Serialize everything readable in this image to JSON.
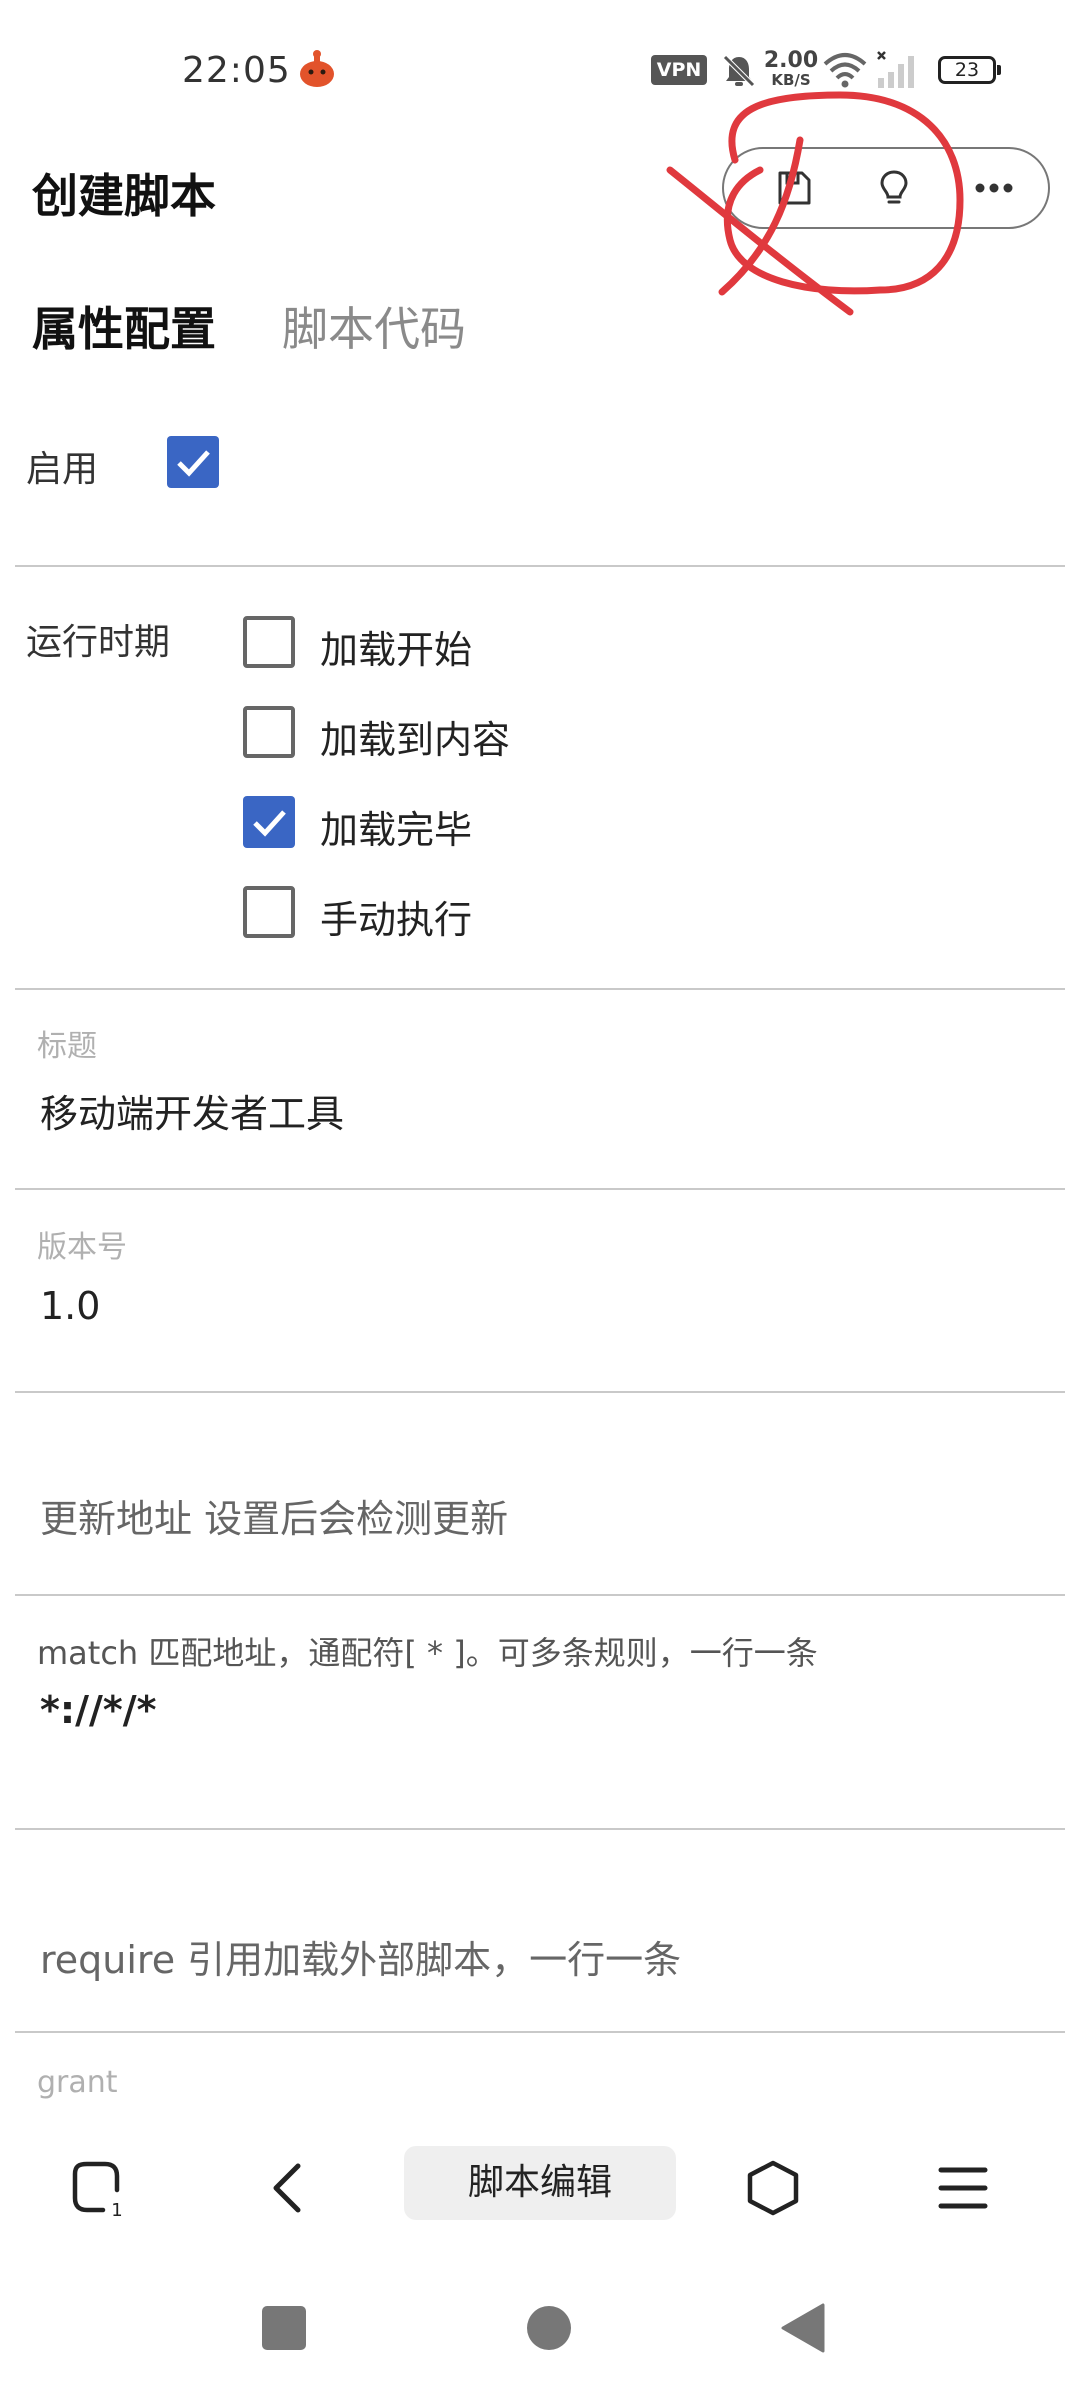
{
  "status_bar": {
    "time": "22:05",
    "vpn": "VPN",
    "net_speed_value": "2.00",
    "net_speed_unit": "KB/S",
    "battery": "23",
    "icons": [
      "app-notification-icon",
      "bell-muted-icon",
      "wifi-icon",
      "signal-icon",
      "battery-icon"
    ]
  },
  "header": {
    "title": "创建脚本",
    "actions": [
      "save-icon",
      "lightbulb-icon",
      "more-icon"
    ]
  },
  "tabs": [
    {
      "label": "属性配置",
      "active": true
    },
    {
      "label": "脚本代码",
      "active": false
    }
  ],
  "form": {
    "enabled_label": "启用",
    "enabled_checked": true,
    "run_at_label": "运行时期",
    "run_at_options": [
      {
        "label": "加载开始",
        "checked": false
      },
      {
        "label": "加载到内容",
        "checked": false
      },
      {
        "label": "加载完毕",
        "checked": true
      },
      {
        "label": "手动执行",
        "checked": false
      }
    ],
    "title_caption": "标题",
    "title_value": "移动端开发者工具",
    "version_caption": "版本号",
    "version_value": "1.0",
    "update_url_placeholder": "更新地址 设置后会检测更新",
    "match_caption": "match 匹配地址，通配符[ * ]。可多条规则，一行一条",
    "match_value": "*://*/*",
    "require_placeholder": "require 引用加载外部脚本，一行一条",
    "grant_caption": "grant"
  },
  "bottom_bar": {
    "center_label": "脚本编辑",
    "tab_count": "1",
    "icons": [
      "tabs-icon",
      "back-icon",
      "home-icon",
      "menu-icon"
    ]
  },
  "system_nav": {
    "icons": [
      "recents-square-icon",
      "home-circle-icon",
      "back-triangle-icon"
    ]
  },
  "colors": {
    "checkbox_checked": "#3a66c4",
    "annotation_stroke": "#e0393e",
    "divider": "#c9c9c9"
  }
}
